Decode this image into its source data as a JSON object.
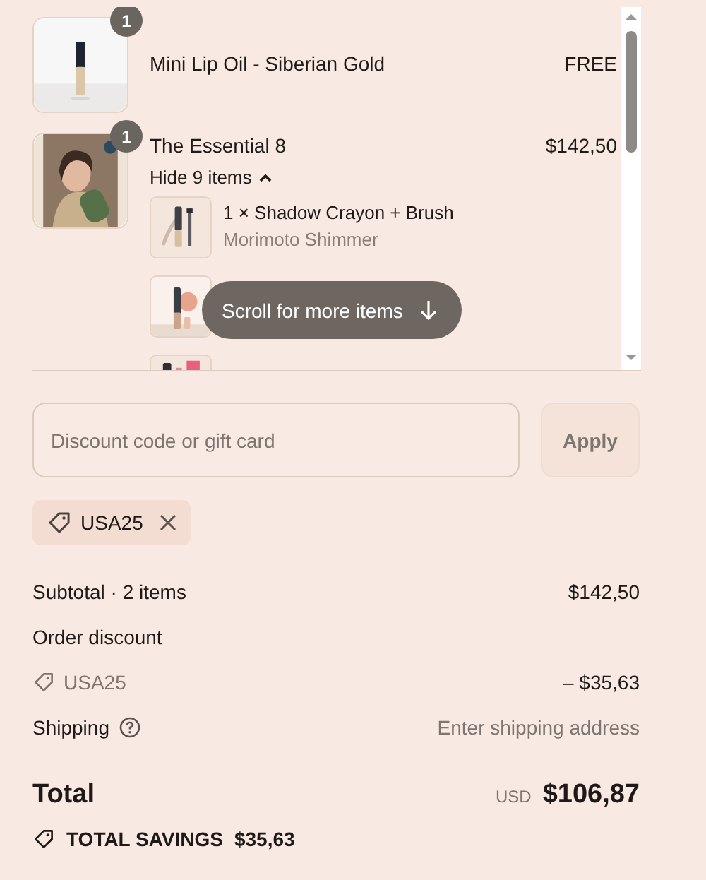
{
  "line_items": [
    {
      "kind": "single",
      "title": "Mini Lip Oil - Siberian Gold",
      "price": "FREE",
      "quantity": "1"
    },
    {
      "kind": "bundle",
      "title": "The Essential 8",
      "price": "$142,50",
      "quantity": "1",
      "toggle": "Hide 9 items",
      "expanded": true,
      "components": [
        {
          "kind": "detail",
          "title": "1 × Shadow Crayon + Brush",
          "variant": "Morimoto Shimmer"
        },
        {
          "kind": "picture"
        },
        {
          "kind": "picture"
        }
      ]
    }
  ],
  "scroll_hint": "Scroll for more items",
  "discount": {
    "placeholder": "Discount code or gift card",
    "button": "Apply"
  },
  "applied_codes": [
    {
      "code": "USA25"
    }
  ],
  "summary": {
    "subtotal_label": "Subtotal · 2 items",
    "subtotal": "$142,50",
    "discount_label": "Order discount",
    "discount_code": "USA25",
    "discount_amount": "– $35,63",
    "shipping_label": "Shipping",
    "shipping_value": "Enter shipping address",
    "total_label": "Total",
    "currency": "USD",
    "total": "$106,87",
    "savings_label": "TOTAL SAVINGS",
    "savings": "$35,63"
  }
}
